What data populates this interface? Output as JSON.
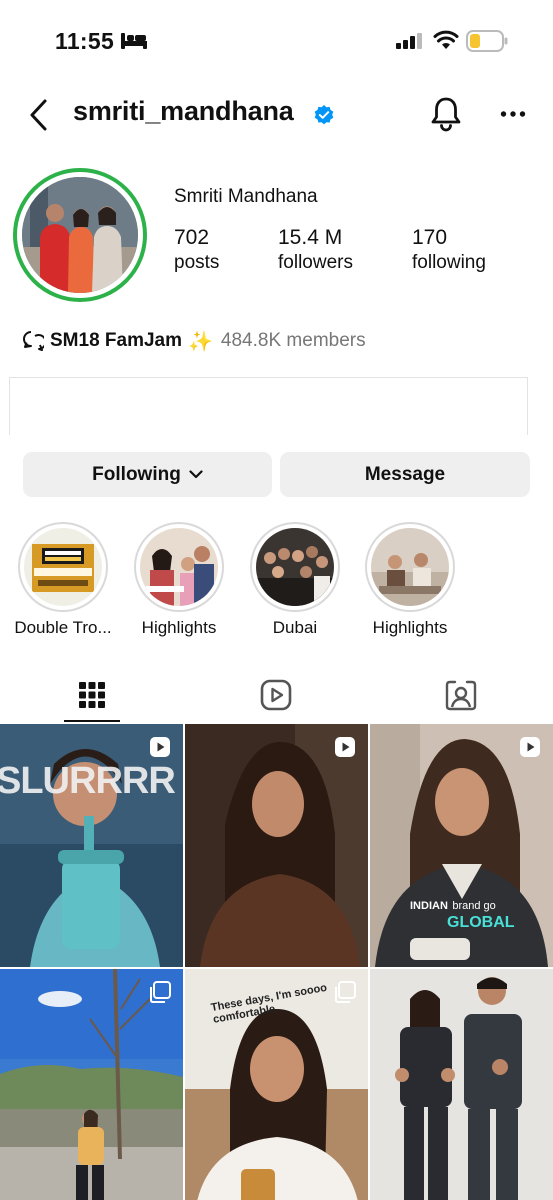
{
  "status_bar": {
    "time": "11:55"
  },
  "header": {
    "username": "smriti_mandhana"
  },
  "profile": {
    "full_name": "Smriti Mandhana",
    "posts_count": "702",
    "posts_label": "posts",
    "followers_count": "15.4 M",
    "followers_label": "followers",
    "following_count": "170",
    "following_label": "following"
  },
  "channel": {
    "name": "SM18 FamJam",
    "spark": "✨",
    "members": "484.8K members"
  },
  "buttons": {
    "following": "Following",
    "message": "Message"
  },
  "highlights": [
    {
      "label": "Double Tro..."
    },
    {
      "label": "Highlights"
    },
    {
      "label": "Dubai"
    },
    {
      "label": "Highlights"
    }
  ],
  "tabs": [
    "grid",
    "reels",
    "tagged"
  ],
  "posts": [
    {
      "type": "reel",
      "caption": "SLURRRR"
    },
    {
      "type": "reel",
      "caption": ""
    },
    {
      "type": "reel",
      "caption_1": "INDIAN",
      "caption_2": "brand go",
      "caption_3": "GLOBAL"
    },
    {
      "type": "carousel",
      "caption": ""
    },
    {
      "type": "carousel",
      "caption": "These days, I'm soooo comfortable."
    },
    {
      "type": "photo",
      "caption": ""
    }
  ],
  "colors": {
    "story_ring": "#2db24a",
    "verified": "#0095f6",
    "button_bg": "#efefef"
  }
}
